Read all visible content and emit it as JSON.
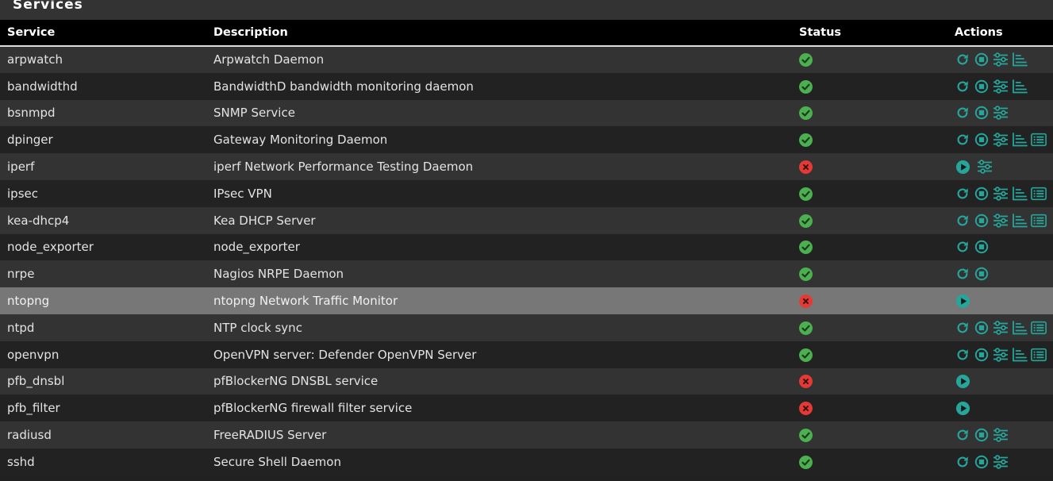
{
  "panel": {
    "title": "Services"
  },
  "colors": {
    "accent": "#26a69a",
    "status_ok": "#4caf50",
    "status_err": "#e53935",
    "highlight_row": "#777777"
  },
  "table": {
    "headers": {
      "service": "Service",
      "description": "Description",
      "status": "Status",
      "actions": "Actions"
    },
    "rows": [
      {
        "service": "arpwatch",
        "description": "Arpwatch Daemon",
        "status": "running",
        "actions": [
          "restart-icon",
          "stop-icon",
          "settings-sliders-icon",
          "status-graph-icon"
        ]
      },
      {
        "service": "bandwidthd",
        "description": "BandwidthD bandwidth monitoring daemon",
        "status": "running",
        "actions": [
          "restart-icon",
          "stop-icon",
          "settings-sliders-icon",
          "status-graph-icon"
        ]
      },
      {
        "service": "bsnmpd",
        "description": "SNMP Service",
        "status": "running",
        "actions": [
          "restart-icon",
          "stop-icon",
          "settings-sliders-icon"
        ]
      },
      {
        "service": "dpinger",
        "description": "Gateway Monitoring Daemon",
        "status": "running",
        "actions": [
          "restart-icon",
          "stop-icon",
          "settings-sliders-icon",
          "status-graph-icon",
          "log-list-icon"
        ]
      },
      {
        "service": "iperf",
        "description": "iperf Network Performance Testing Daemon",
        "status": "stopped",
        "actions": [
          "start-icon",
          "settings-sliders-icon"
        ]
      },
      {
        "service": "ipsec",
        "description": "IPsec VPN",
        "status": "running",
        "actions": [
          "restart-icon",
          "stop-icon",
          "settings-sliders-icon",
          "status-graph-icon",
          "log-list-icon"
        ]
      },
      {
        "service": "kea-dhcp4",
        "description": "Kea DHCP Server",
        "status": "running",
        "actions": [
          "restart-icon",
          "stop-icon",
          "settings-sliders-icon",
          "status-graph-icon",
          "log-list-icon"
        ]
      },
      {
        "service": "node_exporter",
        "description": "node_exporter",
        "status": "running",
        "actions": [
          "restart-icon",
          "stop-icon"
        ]
      },
      {
        "service": "nrpe",
        "description": "Nagios NRPE Daemon",
        "status": "running",
        "actions": [
          "restart-icon",
          "stop-icon"
        ]
      },
      {
        "service": "ntopng",
        "description": "ntopng Network Traffic Monitor",
        "status": "stopped",
        "highlight": true,
        "actions": [
          "start-icon"
        ]
      },
      {
        "service": "ntpd",
        "description": "NTP clock sync",
        "status": "running",
        "actions": [
          "restart-icon",
          "stop-icon",
          "settings-sliders-icon",
          "status-graph-icon",
          "log-list-icon"
        ]
      },
      {
        "service": "openvpn",
        "description": "OpenVPN server: Defender OpenVPN Server",
        "status": "running",
        "actions": [
          "restart-icon",
          "stop-icon",
          "settings-sliders-icon",
          "status-graph-icon",
          "log-list-icon"
        ]
      },
      {
        "service": "pfb_dnsbl",
        "description": "pfBlockerNG DNSBL service",
        "status": "stopped",
        "actions": [
          "start-icon"
        ]
      },
      {
        "service": "pfb_filter",
        "description": "pfBlockerNG firewall filter service",
        "status": "stopped",
        "actions": [
          "start-icon"
        ]
      },
      {
        "service": "radiusd",
        "description": "FreeRADIUS Server",
        "status": "running",
        "actions": [
          "restart-icon",
          "stop-icon",
          "settings-sliders-icon"
        ]
      },
      {
        "service": "sshd",
        "description": "Secure Shell Daemon",
        "status": "running",
        "actions": [
          "restart-icon",
          "stop-icon",
          "settings-sliders-icon"
        ]
      }
    ]
  }
}
